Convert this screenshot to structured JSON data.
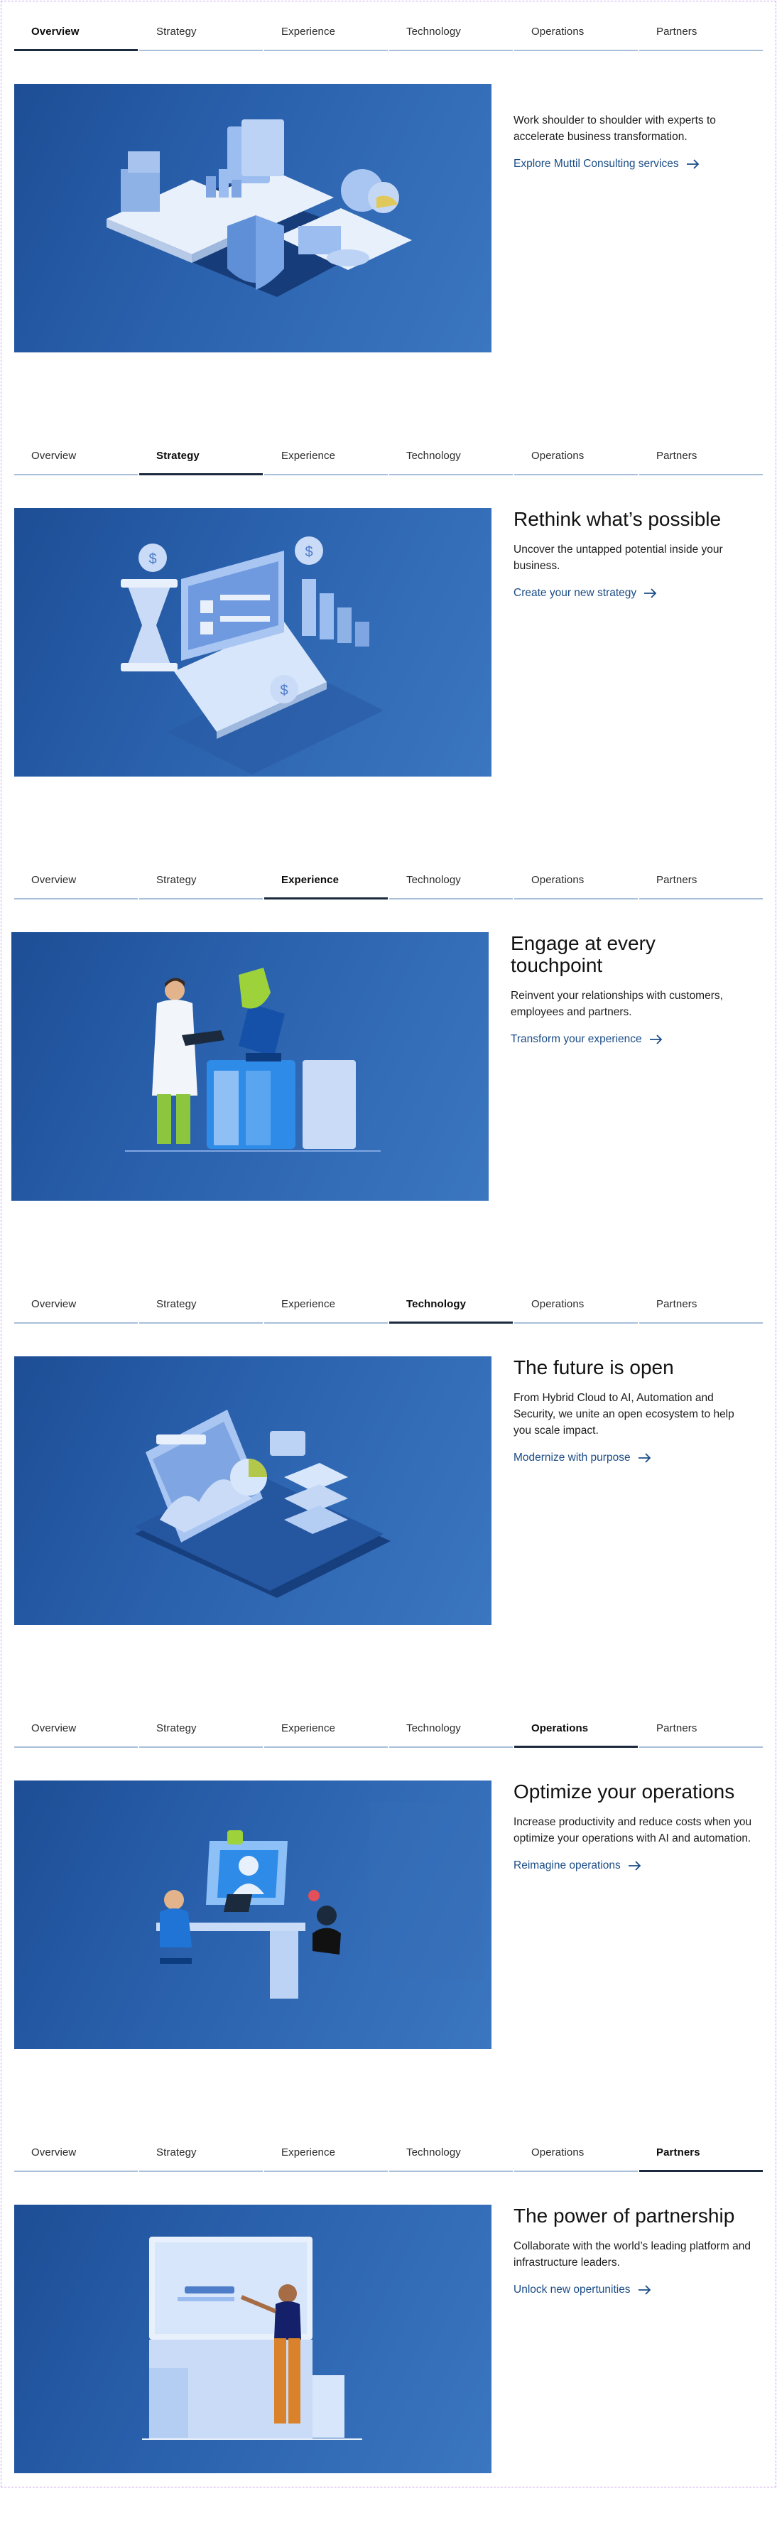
{
  "tabs": [
    "Overview",
    "Strategy",
    "Experience",
    "Technology",
    "Operations",
    "Partners"
  ],
  "colors": {
    "accent_link": "#1b4c86",
    "active_tab_border": "#1b2a3d",
    "tab_border": "#a8bfd9",
    "hero_blue": "#2b62ae"
  },
  "sections": [
    {
      "active_tab": "Overview",
      "title": "",
      "body": "Work shoulder to shoulder with experts to accelerate business transformation.",
      "link": "Explore Muttil Consulting services",
      "illustration": "isometric-data-platform-shield"
    },
    {
      "active_tab": "Strategy",
      "title": "Rethink what’s possible",
      "body": "Uncover the untapped potential inside your business.",
      "link": "Create your new strategy",
      "illustration": "hourglass-laptop-bar-chart-coins"
    },
    {
      "active_tab": "Experience",
      "title": "Engage at every touchpoint",
      "body": "Reinvent your relationships with customers, employees and partners.",
      "link": "Transform your experience",
      "illustration": "scientist-with-laptop-servers"
    },
    {
      "active_tab": "Technology",
      "title": "The future is open",
      "body": "From Hybrid Cloud to AI, Automation and Security, we unite an open ecosystem to help you scale impact.",
      "link": "Modernize with purpose",
      "illustration": "cloud-dashboard-platform"
    },
    {
      "active_tab": "Operations",
      "title": "Optimize your operations",
      "body": "Increase productivity and reduce costs when you optimize your operations with AI and automation.",
      "link": "Reimagine operations",
      "illustration": "operator-at-desk-security-threat"
    },
    {
      "active_tab": "Partners",
      "title": "The power of partnership",
      "body": "Collaborate with the world’s leading platform and infrastructure leaders.",
      "link": "Unlock new opertunities",
      "illustration": "person-presenting-at-board"
    }
  ]
}
